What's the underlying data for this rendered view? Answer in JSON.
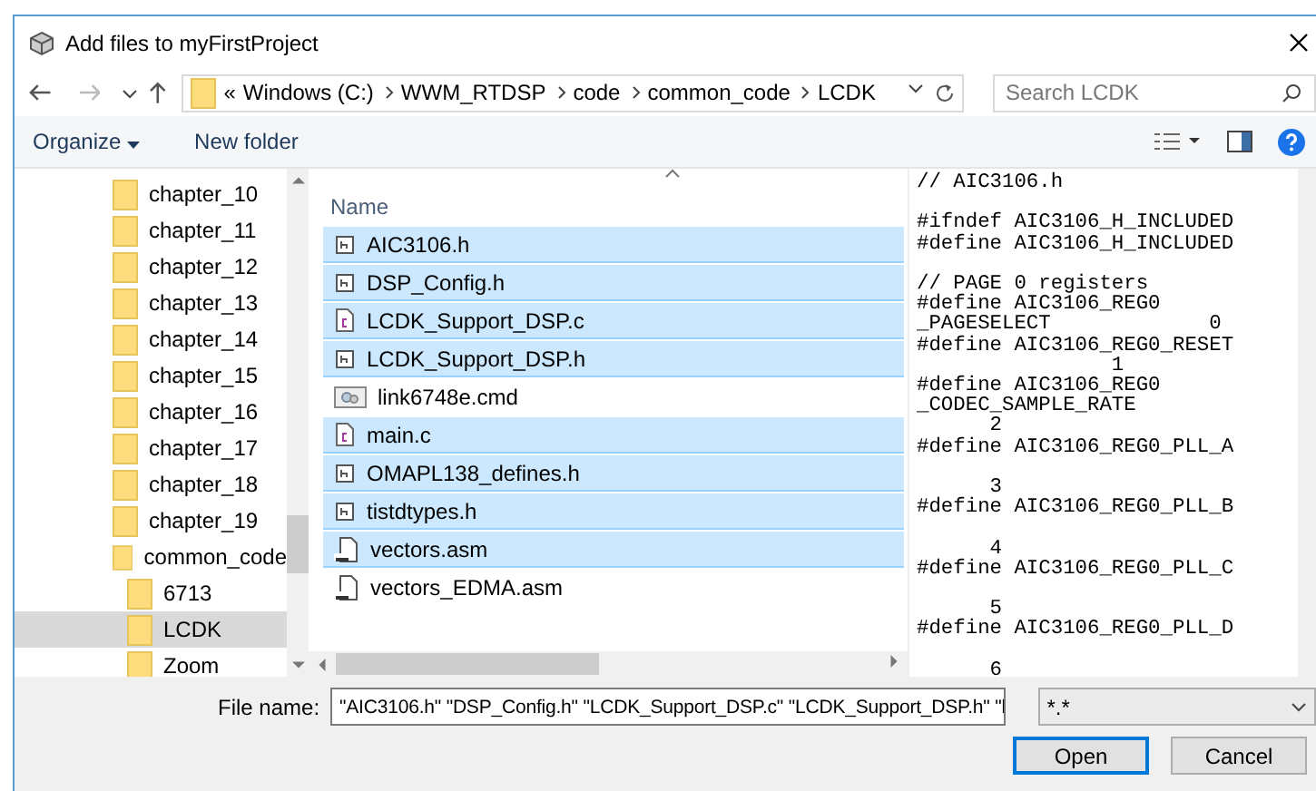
{
  "window": {
    "title": "Add files to myFirstProject"
  },
  "address_bar": {
    "prefix": "«",
    "path": [
      "Windows (C:)",
      "WWM_RTDSP",
      "code",
      "common_code",
      "LCDK"
    ]
  },
  "search": {
    "placeholder": "Search LCDK"
  },
  "toolbar": {
    "organize": "Organize",
    "new_folder": "New folder"
  },
  "nav_tree": [
    {
      "label": "chapter_10",
      "selected": false
    },
    {
      "label": "chapter_11",
      "selected": false
    },
    {
      "label": "chapter_12",
      "selected": false
    },
    {
      "label": "chapter_13",
      "selected": false
    },
    {
      "label": "chapter_14",
      "selected": false
    },
    {
      "label": "chapter_15",
      "selected": false
    },
    {
      "label": "chapter_16",
      "selected": false
    },
    {
      "label": "chapter_17",
      "selected": false
    },
    {
      "label": "chapter_18",
      "selected": false
    },
    {
      "label": "chapter_19",
      "selected": false
    },
    {
      "label": "common_code",
      "selected": false,
      "children": [
        {
          "label": "6713",
          "selected": false
        },
        {
          "label": "LCDK",
          "selected": true
        },
        {
          "label": "Zoom",
          "selected": false
        }
      ]
    }
  ],
  "file_list": {
    "column": "Name",
    "files": [
      {
        "name": "AIC3106.h",
        "kind": "header",
        "selected": true
      },
      {
        "name": "DSP_Config.h",
        "kind": "header",
        "selected": true
      },
      {
        "name": "LCDK_Support_DSP.c",
        "kind": "c",
        "selected": true
      },
      {
        "name": "LCDK_Support_DSP.h",
        "kind": "header",
        "selected": true
      },
      {
        "name": "link6748e.cmd",
        "kind": "cmd",
        "selected": false
      },
      {
        "name": "main.c",
        "kind": "c",
        "selected": true
      },
      {
        "name": "OMAPL138_defines.h",
        "kind": "header",
        "selected": true
      },
      {
        "name": "tistdtypes.h",
        "kind": "header",
        "selected": true
      },
      {
        "name": "vectors.asm",
        "kind": "asm",
        "selected": true
      },
      {
        "name": "vectors_EDMA.asm",
        "kind": "asm",
        "selected": false
      }
    ]
  },
  "preview": "// AIC3106.h\n\n#ifndef AIC3106_H_INCLUDED\n#define AIC3106_H_INCLUDED\n\n// PAGE 0 registers\n#define AIC3106_REG0\n_PAGESELECT             0\n#define AIC3106_REG0_RESET\n                1\n#define AIC3106_REG0\n_CODEC_SAMPLE_RATE\n      2\n#define AIC3106_REG0_PLL_A\n\n      3\n#define AIC3106_REG0_PLL_B\n\n      4\n#define AIC3106_REG0_PLL_C\n\n      5\n#define AIC3106_REG0_PLL_D\n\n      6",
  "file_name": {
    "label": "File name:",
    "value": "\"AIC3106.h\" \"DSP_Config.h\" \"LCDK_Support_DSP.c\" \"LCDK_Support_DSP.h\" \"l"
  },
  "file_type": {
    "value": "*.*"
  },
  "buttons": [
    {
      "label": "Open",
      "kind": "default"
    },
    {
      "label": "Cancel",
      "kind": "normal"
    }
  ]
}
